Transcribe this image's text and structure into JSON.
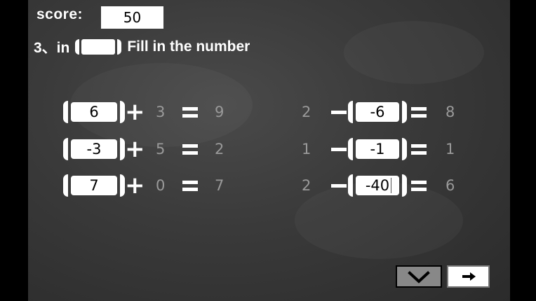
{
  "score": {
    "label": "score:",
    "value": "50"
  },
  "instruction": {
    "prefix": "3、in (",
    "suffix": ") Fill in the number"
  },
  "equations_left": [
    {
      "answer": "6",
      "op": "+",
      "operand": "3",
      "result": "9"
    },
    {
      "answer": "-3",
      "op": "+",
      "operand": "5",
      "result": "2"
    },
    {
      "answer": "7",
      "op": "+",
      "operand": "0",
      "result": "7"
    }
  ],
  "equations_right": [
    {
      "first": "2",
      "op": "−",
      "answer": "-6",
      "result": "8"
    },
    {
      "first": "1",
      "op": "−",
      "answer": "-1",
      "result": "1"
    },
    {
      "first": "2",
      "op": "−",
      "answer": "-40",
      "result": "6"
    }
  ],
  "buttons": {
    "check_icon": "checkmark-icon",
    "next_icon": "arrow-right-icon"
  }
}
